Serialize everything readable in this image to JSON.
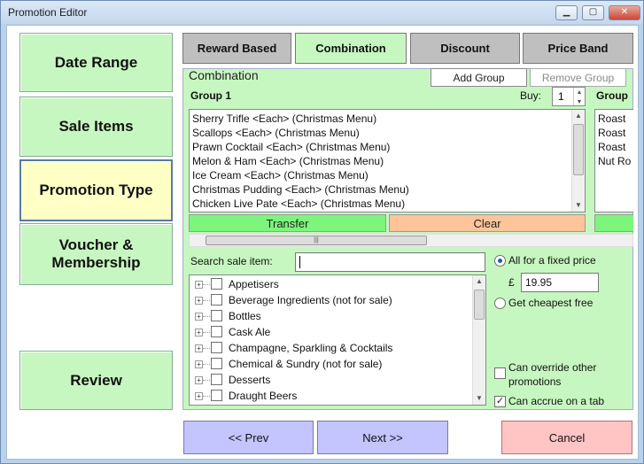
{
  "window": {
    "title": "Promotion Editor",
    "min_label": "▁",
    "max_label": "▢",
    "close_label": "✕"
  },
  "nav": [
    {
      "label": "Date Range"
    },
    {
      "label": "Sale Items"
    },
    {
      "label": "Promotion Type"
    },
    {
      "label": "Voucher & Membership"
    },
    {
      "label": "Review"
    }
  ],
  "tabs": [
    {
      "label": "Reward Based"
    },
    {
      "label": "Combination"
    },
    {
      "label": "Discount"
    },
    {
      "label": "Price Band"
    }
  ],
  "panel": {
    "title": "Combination",
    "add_group": "Add Group",
    "remove_group": "Remove Group",
    "group1": {
      "label": "Group 1",
      "buy_label": "Buy:",
      "buy_value": "1",
      "items": [
        "Sherry Trifle <Each> (Christmas Menu)",
        "Scallops <Each> (Christmas Menu)",
        "Prawn Cocktail <Each> (Christmas Menu)",
        "Melon & Ham <Each> (Christmas Menu)",
        "Ice Cream <Each> (Christmas Menu)",
        "Christmas Pudding <Each> (Christmas Menu)",
        "Chicken Live Pate <Each> (Christmas Menu)"
      ],
      "transfer": "Transfer",
      "clear": "Clear"
    },
    "group2": {
      "label": "Group",
      "items": [
        "Roast",
        "Roast",
        "Roast",
        "Nut Ro"
      ]
    },
    "search_label": "Search sale item:",
    "search_value": "",
    "tree_items": [
      "Appetisers",
      "Beverage Ingredients (not for sale)",
      "Bottles",
      "Cask Ale",
      "Champagne, Sparkling & Cocktails",
      "Chemical & Sundry (not for sale)",
      "Desserts",
      "Draught Beers"
    ],
    "fixed_price_label": "All for a fixed price",
    "currency_symbol": "£",
    "fixed_price_value": "19.95",
    "cheapest_label": "Get cheapest free",
    "override_label": "Can override other promotions",
    "accrue_label": "Can accrue on a tab"
  },
  "footer": {
    "prev": "<< Prev",
    "next": "Next >>",
    "cancel": "Cancel"
  },
  "colors": {
    "panel_green": "#c7f7c0",
    "active_nav": "#ffffc6",
    "transfer": "#7df57d",
    "clear": "#ffc49a",
    "nav_blue": "#c4c4ff",
    "cancel": "#ffc4c4"
  }
}
